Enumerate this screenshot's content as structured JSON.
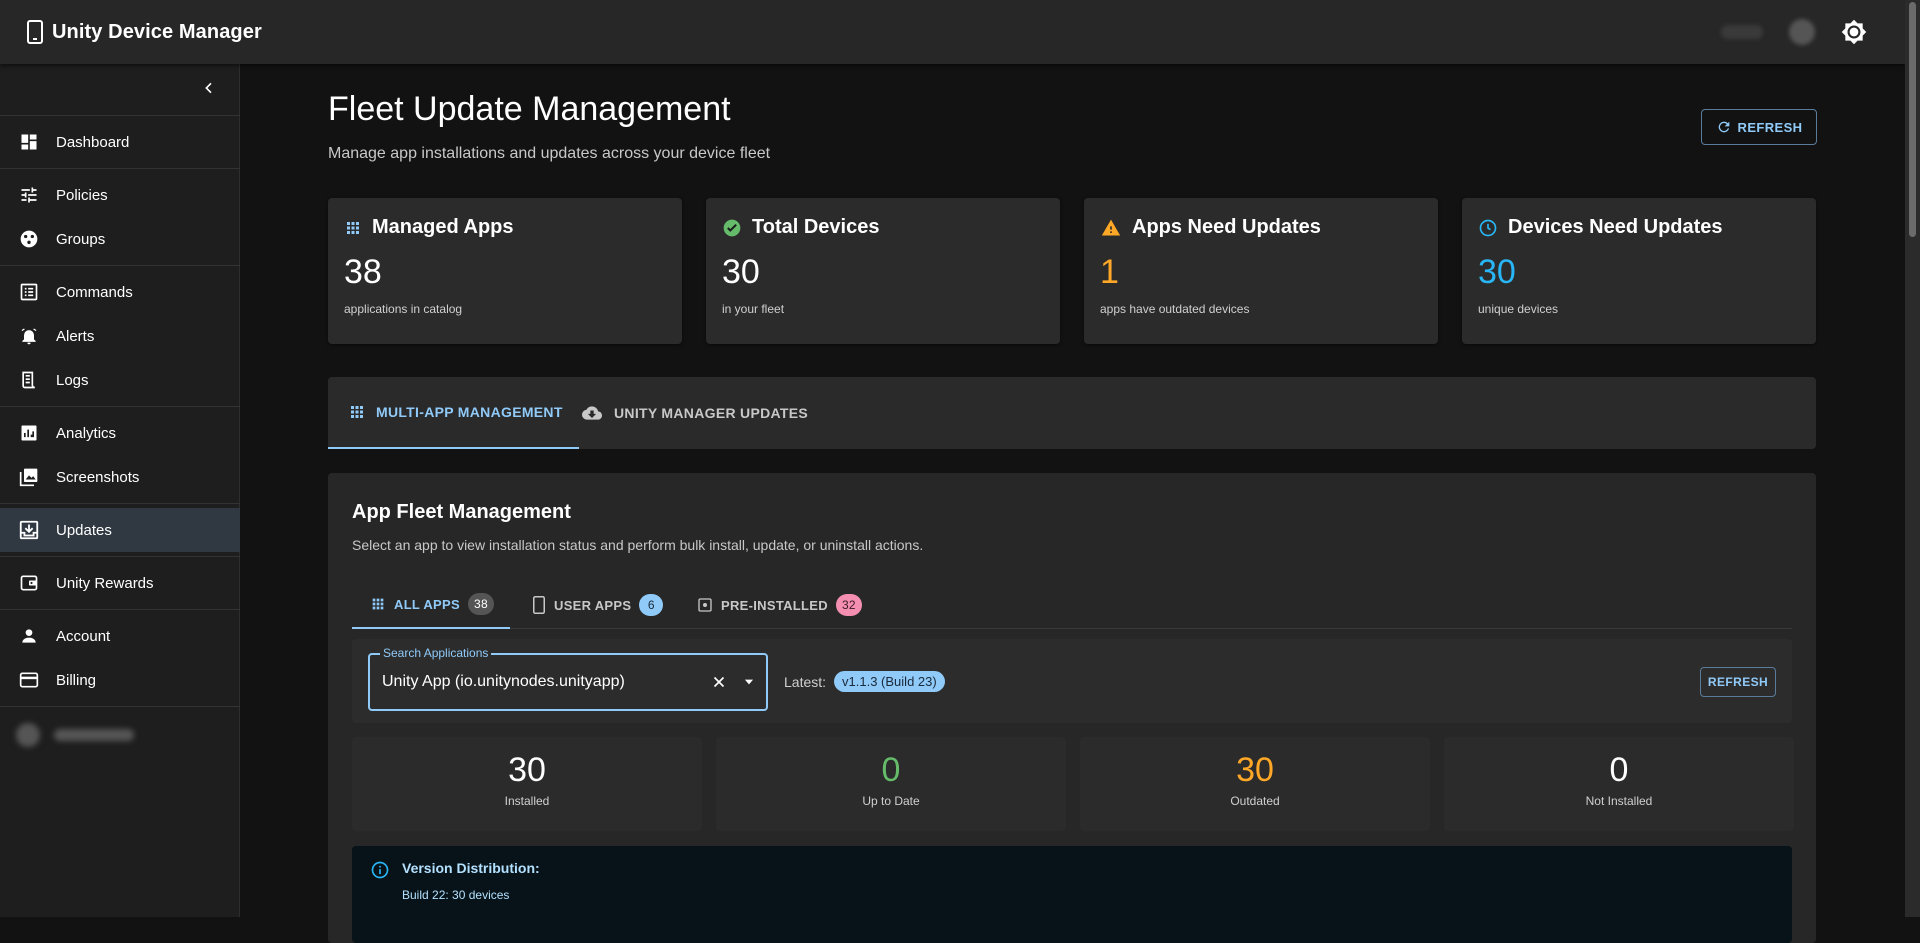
{
  "app": {
    "title": "Unity Device Manager"
  },
  "colors": {
    "accent": "#90caf9",
    "success": "#66bb6a",
    "warning": "#ffa726",
    "info": "#29b6f6",
    "pink": "#f48fb1"
  },
  "sidebar": {
    "items": [
      {
        "label": "Dashboard",
        "icon": "dashboard-icon"
      },
      {
        "label": "Policies",
        "icon": "tune-icon"
      },
      {
        "label": "Groups",
        "icon": "groups-icon"
      },
      {
        "label": "Commands",
        "icon": "list-icon"
      },
      {
        "label": "Alerts",
        "icon": "alarm-icon"
      },
      {
        "label": "Logs",
        "icon": "receipt-icon"
      },
      {
        "label": "Analytics",
        "icon": "analytics-icon"
      },
      {
        "label": "Screenshots",
        "icon": "photo-library-icon"
      },
      {
        "label": "Updates",
        "icon": "download-icon"
      },
      {
        "label": "Unity Rewards",
        "icon": "wallet-icon"
      },
      {
        "label": "Account",
        "icon": "person-icon"
      },
      {
        "label": "Billing",
        "icon": "credit-card-icon"
      }
    ]
  },
  "page": {
    "title": "Fleet Update Management",
    "subtitle": "Manage app installations and updates across your device fleet",
    "refresh_label": "REFRESH"
  },
  "stats": [
    {
      "title": "Managed Apps",
      "value": "38",
      "sub": "applications in catalog"
    },
    {
      "title": "Total Devices",
      "value": "30",
      "sub": "in your fleet"
    },
    {
      "title": "Apps Need Updates",
      "value": "1",
      "sub": "apps have outdated devices"
    },
    {
      "title": "Devices Need Updates",
      "value": "30",
      "sub": "unique devices"
    }
  ],
  "tabs": [
    {
      "label": "MULTI-APP MANAGEMENT"
    },
    {
      "label": "UNITY MANAGER UPDATES"
    }
  ],
  "panel": {
    "title": "App Fleet Management",
    "subtitle": "Select an app to view installation status and perform bulk install, update, or uninstall actions.",
    "subtabs": [
      {
        "label": "ALL APPS",
        "count": "38"
      },
      {
        "label": "USER APPS",
        "count": "6"
      },
      {
        "label": "PRE-INSTALLED",
        "count": "32"
      }
    ],
    "search": {
      "label": "Search Applications",
      "value": "Unity App (io.unitynodes.unityapp)"
    },
    "latest_label": "Latest:",
    "latest_value": "v1.1.3 (Build 23)",
    "refresh_label": "REFRESH",
    "metrics": [
      {
        "value": "30",
        "label": "Installed"
      },
      {
        "value": "0",
        "label": "Up to Date"
      },
      {
        "value": "30",
        "label": "Outdated"
      },
      {
        "value": "0",
        "label": "Not Installed"
      }
    ],
    "info": {
      "heading": "Version Distribution:",
      "line": "Build 22: 30 devices"
    }
  }
}
